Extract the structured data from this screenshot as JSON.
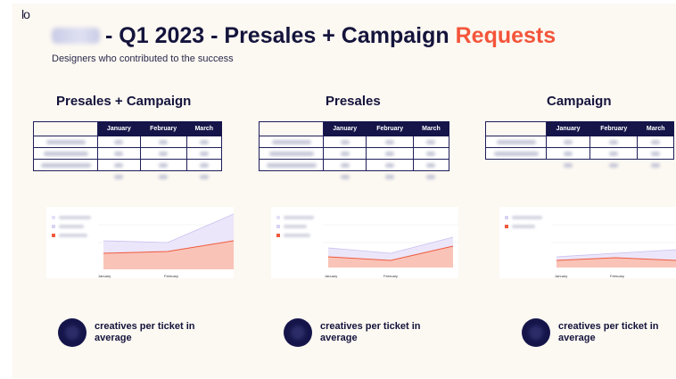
{
  "logo": "lo",
  "title": {
    "prefix": "- Q1 2023 - Presales + Campaign",
    "accent": "Requests"
  },
  "subtitle": "Designers who contributed to the success",
  "columns": [
    {
      "title": "Presales + Campaign",
      "months": [
        "January",
        "February",
        "March"
      ],
      "stat": "creatives per ticket in average",
      "chart_axis": [
        "January",
        "February"
      ]
    },
    {
      "title": "Presales",
      "months": [
        "January",
        "February",
        "March"
      ],
      "stat": "creatives per ticket in average",
      "chart_axis": [
        "January",
        "February"
      ]
    },
    {
      "title": "Campaign",
      "months": [
        "January",
        "February",
        "March"
      ],
      "stat": "creatives per ticket in average",
      "chart_axis": [
        "January",
        "February"
      ]
    }
  ],
  "colors": {
    "navy": "#15154a",
    "accent": "#f3553a",
    "area_top": "#e6e0f8",
    "area_bottom": "#f9c3b8",
    "line_bottom": "#f05a3c"
  }
}
